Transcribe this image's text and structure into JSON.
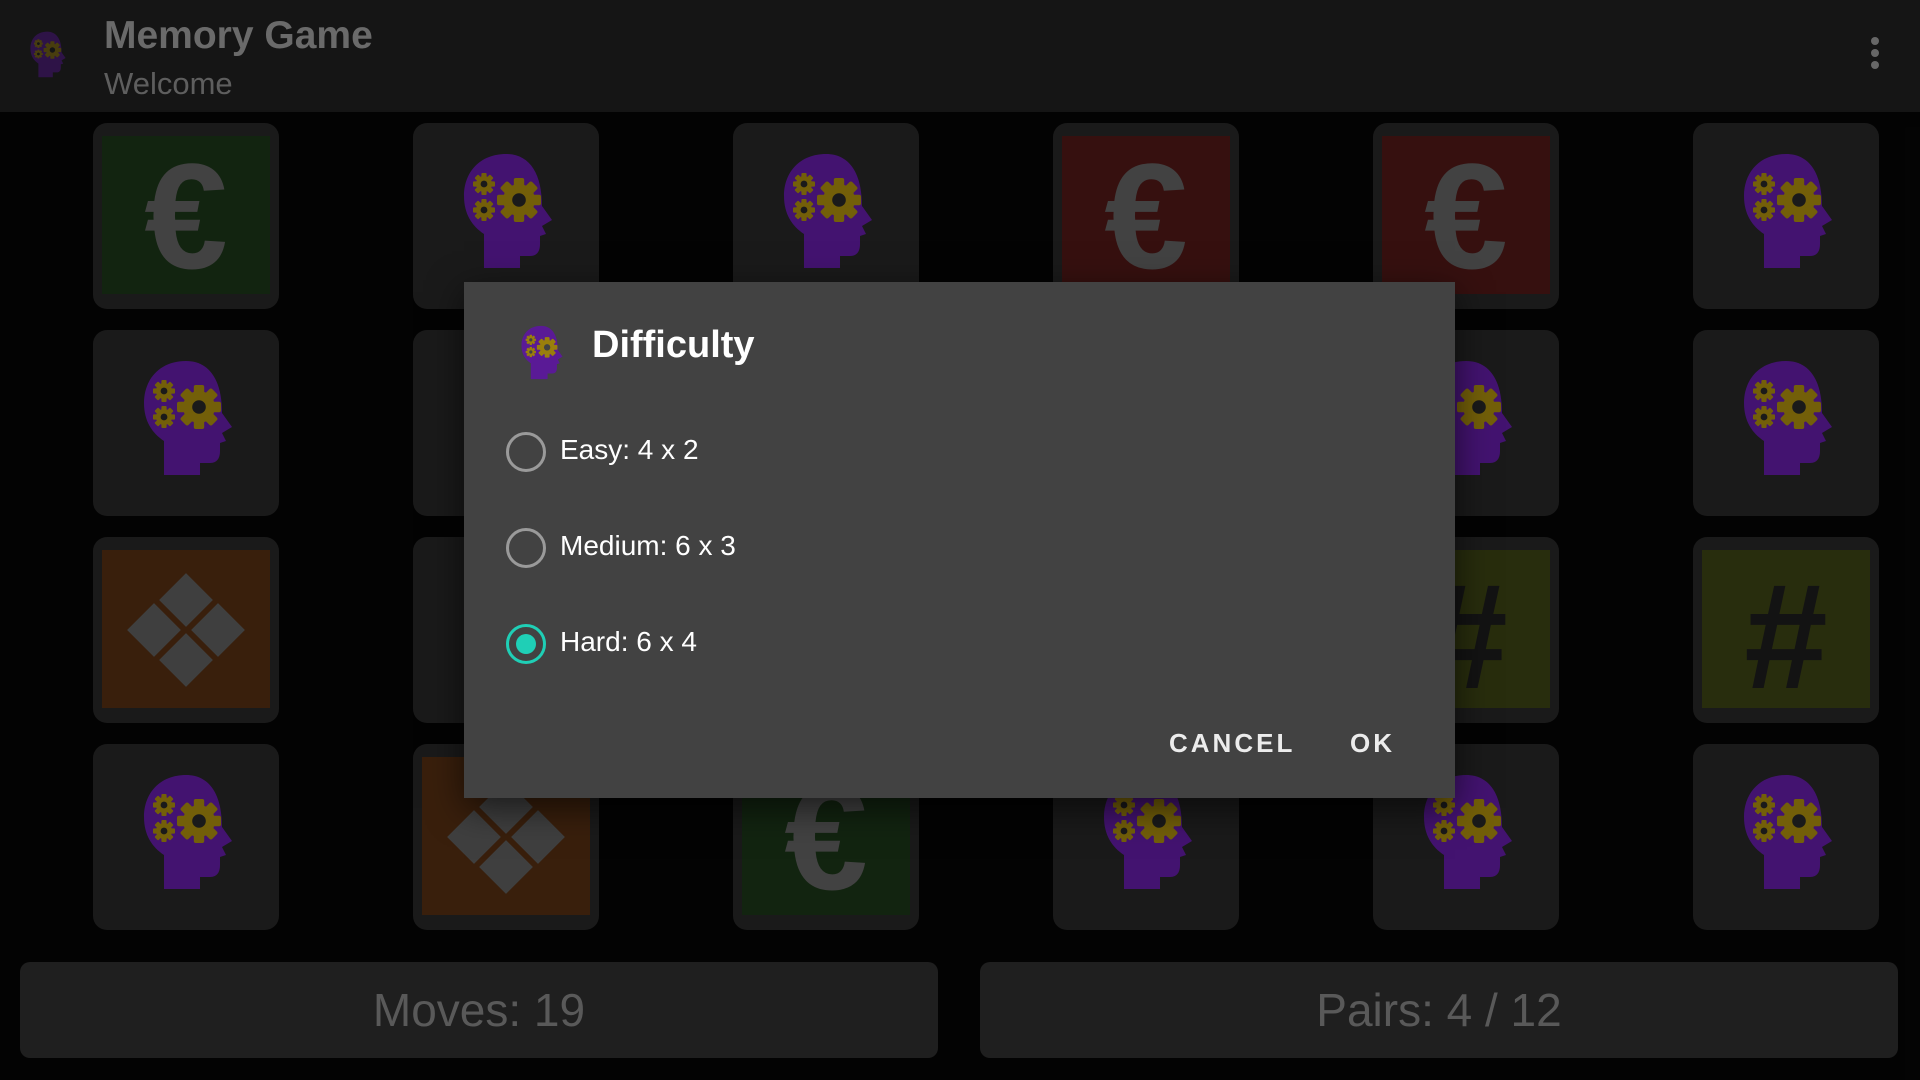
{
  "app": {
    "title": "Memory Game",
    "subtitle": "Welcome"
  },
  "cards": [
    {
      "face": "euro",
      "color": "green"
    },
    {
      "face": "brain"
    },
    {
      "face": "brain"
    },
    {
      "face": "euro",
      "color": "red"
    },
    {
      "face": "euro",
      "color": "red"
    },
    {
      "face": "brain"
    },
    {
      "face": "brain"
    },
    {
      "face": "brain"
    },
    {
      "face": "brain"
    },
    {
      "face": "brain"
    },
    {
      "face": "brain"
    },
    {
      "face": "brain"
    },
    {
      "face": "diamond"
    },
    {
      "face": "brain"
    },
    {
      "face": "brain"
    },
    {
      "face": "hash"
    },
    {
      "face": "hash"
    },
    {
      "face": "hash"
    },
    {
      "face": "brain"
    },
    {
      "face": "diamond"
    },
    {
      "face": "euro",
      "color": "green"
    },
    {
      "face": "brain"
    },
    {
      "face": "brain"
    },
    {
      "face": "brain"
    }
  ],
  "dialog": {
    "title": "Difficulty",
    "icon": "brain-gears-icon",
    "options": [
      {
        "label": "Easy: 4 x 2",
        "checked": false
      },
      {
        "label": "Medium: 6 x 3",
        "checked": false
      },
      {
        "label": "Hard: 6 x 4",
        "checked": true
      }
    ],
    "cancel_label": "CANCEL",
    "ok_label": "OK"
  },
  "stats": {
    "moves": "Moves: 19",
    "pairs": "Pairs: 4 / 12"
  },
  "colors": {
    "accent": "#1fcfb6",
    "brain": "#5a1a96",
    "gear": "#9a7f0c"
  }
}
